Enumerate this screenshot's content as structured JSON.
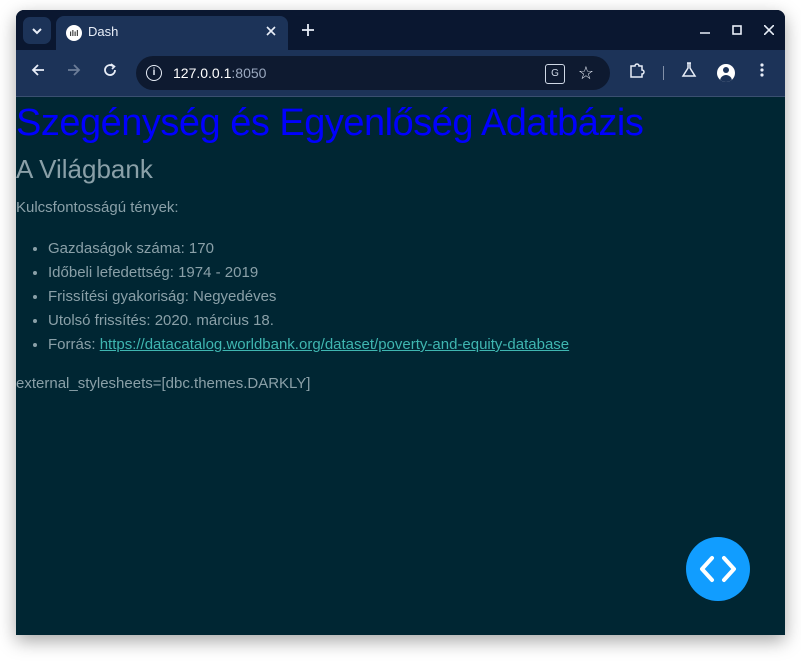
{
  "browser": {
    "tab_title": "Dash",
    "tab_favicon": "ılıl",
    "url_host": "127.0.0.1",
    "url_port": ":8050"
  },
  "page": {
    "title": "Szegénység és Egyenlőség Adatbázis",
    "subtitle": "A Világbank",
    "facts_label": "Kulcsfontosságú tények:",
    "facts": [
      "Gazdaságok száma: 170",
      "Időbeli lefedettség: 1974 - 2019",
      "Frissítési gyakoriság: Negyedéves",
      "Utolsó frissítés: 2020. március 18."
    ],
    "source_label": "Forrás: ",
    "source_link": "https://datacatalog.worldbank.org/dataset/poverty-and-equity-database",
    "stylesheets_note": "external_stylesheets=[dbc.themes.DARKLY]"
  },
  "colors": {
    "title": "#0000ff",
    "page_background": "#002633",
    "link": "#3fb6b1",
    "debug_button": "#119dff"
  },
  "icons": {
    "tab_search": "chevron-down-icon",
    "new_tab": "plus-icon",
    "back": "arrow-left-icon",
    "forward": "arrow-right-icon",
    "reload": "reload-icon",
    "site_info": "info-icon",
    "translate": "translate-icon",
    "bookmark": "star-icon",
    "extensions": "puzzle-icon",
    "labs": "flask-icon",
    "profile": "avatar-icon",
    "menu": "kebab-menu-icon",
    "debug": "code-brackets-icon"
  }
}
